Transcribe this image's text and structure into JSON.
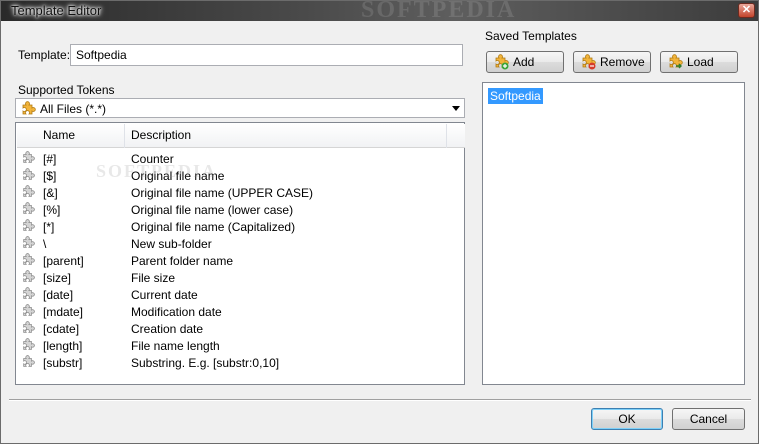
{
  "window": {
    "title": "Template Editor",
    "close_glyph": "✕"
  },
  "template": {
    "label": "Template:",
    "value": "Softpedia"
  },
  "tokens": {
    "group_label": "Supported Tokens",
    "filter_selected": "All Files (*.*)",
    "filter_icon": "puzzle-icon",
    "columns": [
      "Name",
      "Description"
    ],
    "rows": [
      {
        "name": "[#]",
        "description": "Counter"
      },
      {
        "name": "[$]",
        "description": "Original file name"
      },
      {
        "name": "[&]",
        "description": "Original file name (UPPER CASE)"
      },
      {
        "name": "[%]",
        "description": "Original file name (lower case)"
      },
      {
        "name": "[*]",
        "description": "Original file name (Capitalized)"
      },
      {
        "name": "\\",
        "description": "New sub-folder"
      },
      {
        "name": "[parent]",
        "description": "Parent folder name"
      },
      {
        "name": "[size]",
        "description": "File size"
      },
      {
        "name": "[date]",
        "description": "Current date"
      },
      {
        "name": "[mdate]",
        "description": "Modification date"
      },
      {
        "name": "[cdate]",
        "description": "Creation date"
      },
      {
        "name": "[length]",
        "description": "File name length"
      },
      {
        "name": "[substr]",
        "description": "Substring. E.g. [substr:0,10]"
      }
    ]
  },
  "saved": {
    "group_label": "Saved Templates",
    "add_label": "Add",
    "remove_label": "Remove",
    "load_label": "Load",
    "items": [
      "Softpedia"
    ]
  },
  "footer": {
    "ok_label": "OK",
    "cancel_label": "Cancel"
  },
  "watermark": "SOFTPEDIA"
}
